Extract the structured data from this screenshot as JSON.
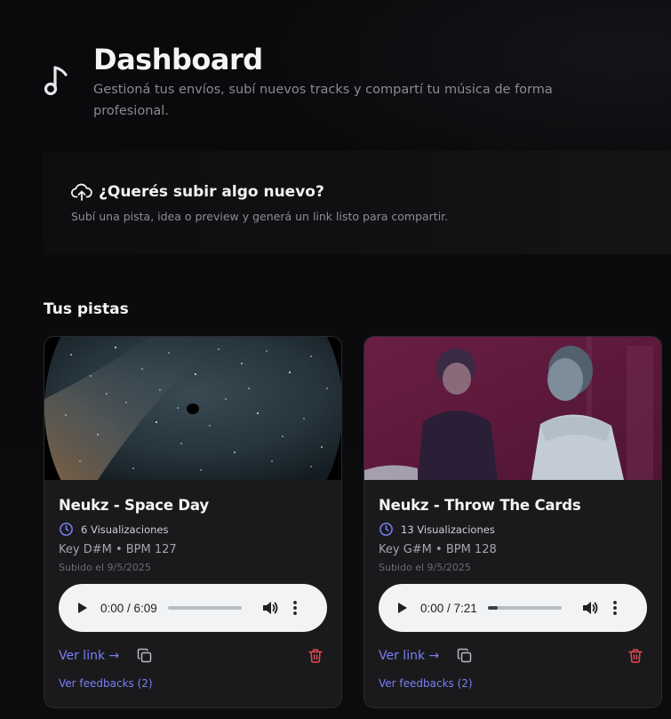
{
  "header": {
    "title": "Dashboard",
    "subtitle": "Gestioná tus envíos, subí nuevos tracks y compartí tu música de forma profesional."
  },
  "upload": {
    "title": "¿Querés subir algo nuevo?",
    "description": "Subí una pista, idea o preview y generá un link listo para compartir."
  },
  "tracks_section": {
    "title": "Tus pistas",
    "tracks": [
      {
        "title": "Neukz - Space Day",
        "views": "6 Visualizaciones",
        "meta": "Key D#M • BPM 127",
        "uploaded": "Subido el 9/5/2025",
        "time": "0:00 / 6:09",
        "progress": 0.0,
        "link_label": "Ver link →",
        "feedback_label": "Ver feedbacks (2)"
      },
      {
        "title": "Neukz - Throw The Cards",
        "views": "13 Visualizaciones",
        "meta": "Key G#M • BPM 128",
        "uploaded": "Subido el 9/5/2025",
        "time": "0:00 / 7:21",
        "progress": 0.14,
        "link_label": "Ver link →",
        "feedback_label": "Ver feedbacks (2)"
      }
    ]
  },
  "colors": {
    "accent": "#7b7ff5",
    "danger": "#e5484d",
    "card_bg": "#1a1a1c"
  }
}
